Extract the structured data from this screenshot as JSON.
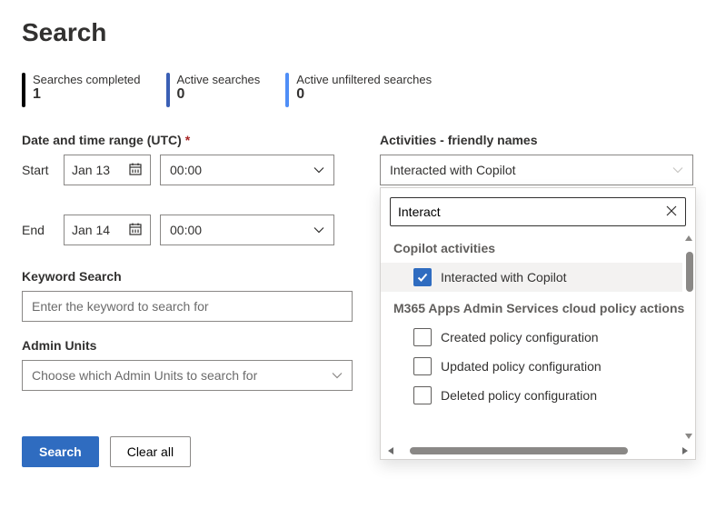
{
  "page": {
    "title": "Search"
  },
  "stats": {
    "completed": {
      "label": "Searches completed",
      "value": "1"
    },
    "active": {
      "label": "Active searches",
      "value": "0"
    },
    "unfiltered": {
      "label": "Active unfiltered searches",
      "value": "0"
    }
  },
  "dateRange": {
    "label": "Date and time range (UTC)",
    "required_marker": "*",
    "start_label": "Start",
    "end_label": "End",
    "start_date": "Jan 13",
    "start_time": "00:00",
    "end_date": "Jan 14",
    "end_time": "00:00"
  },
  "keyword": {
    "label": "Keyword Search",
    "placeholder": "Enter the keyword to search for"
  },
  "adminUnits": {
    "label": "Admin Units",
    "placeholder": "Choose which Admin Units to search for"
  },
  "buttons": {
    "search": "Search",
    "clear": "Clear all"
  },
  "activities": {
    "label": "Activities - friendly names",
    "selected": "Interacted with Copilot",
    "search_value": "Interact",
    "groups": [
      {
        "title": "Copilot activities",
        "items": [
          {
            "label": "Interacted with Copilot",
            "checked": true
          }
        ]
      },
      {
        "title": "M365 Apps Admin Services cloud policy actions",
        "items": [
          {
            "label": "Created policy configuration",
            "checked": false
          },
          {
            "label": "Updated policy configuration",
            "checked": false
          },
          {
            "label": "Deleted policy configuration",
            "checked": false
          }
        ]
      }
    ]
  }
}
